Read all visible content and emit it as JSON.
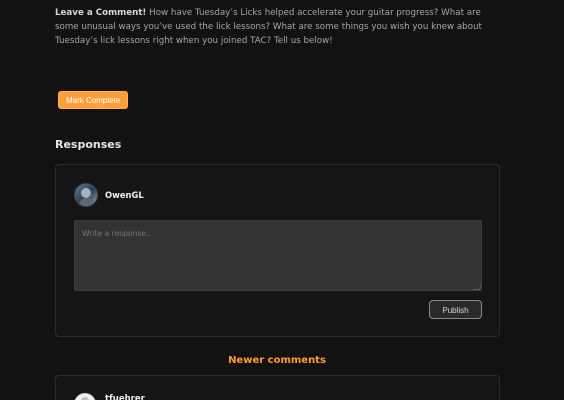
{
  "intro": {
    "lead": "Leave a Comment!",
    "text": " How have Tuesday’s Licks helped accelerate your guitar progress? What are some unusual ways you’ve used the lick lessons? What are some things you wish you knew about Tuesday’s lick lessons right when you joined TAC? Tell us below!"
  },
  "actions": {
    "mark_complete": "Mark Complete"
  },
  "responses": {
    "title": "Responses",
    "current_user": "OwenGL",
    "placeholder": "Write a response...",
    "publish": "Publish"
  },
  "comments": {
    "newer_label": "Newer comments",
    "next_user": "tfuehrer"
  }
}
